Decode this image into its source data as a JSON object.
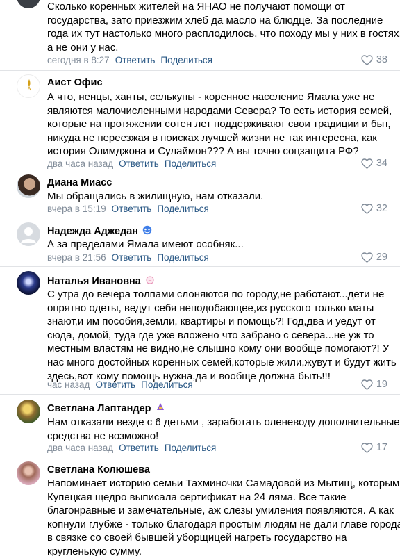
{
  "actions": {
    "reply": "Ответить",
    "share": "Поделиться"
  },
  "comments": [
    {
      "name": "",
      "lines": [
        "Сколько коренных жителей на ЯНАО не получают помощи от",
        "государства, зато приезжим хлеб да масло на блюдце. За последние",
        "года их тут настолько много расплодилось, что походу мы у них в гостях,",
        "а не они у нас."
      ],
      "time": "сегодня в 8:27",
      "likes": "38"
    },
    {
      "name": "Аист Офис",
      "avatar_logo": "АИСТ-АСТ",
      "lines": [
        "А что, ненцы, ханты, селькупы - коренное население Ямала уже не",
        "являются малочисленными народами Севера? То есть история семей,",
        "которые на протяжении сотен лет поддерживают свои традиции и быт,",
        "никуда не переезжая в поисках лучшей жизни не так интересна, как",
        "история Олимджона и Сулаймон??? А вы точно соцзащита РФ?"
      ],
      "time": "два часа назад",
      "likes": "34"
    },
    {
      "name": "Диана Миасс",
      "lines": [
        "Мы обращались в жилищную, нам отказали."
      ],
      "time": "вчера в 15:19",
      "likes": "32"
    },
    {
      "name": "Надежда Аджедан",
      "lines": [
        "А за пределами Ямала имеют особняк..."
      ],
      "time": "вчера в 21:56",
      "likes": "29"
    },
    {
      "name": "Наталья Ивановна",
      "lines": [
        "С утра до вечера толпами слоняются по городу,не работают...дети не",
        "опрятно одеты, ведут себя неподобающее,из русского только маты",
        "знают,и им пособия,земли, квартиры и помощь?! Год,два и уедут от",
        "сюда, домой, туда где уже вложено что забрано с севера...не уж то",
        "местным властям не видно,не слышно кому они вообще помогают?! У",
        "нас много достойных коренных семей,которые жили,жувут и будут жить",
        "здесь,вот кому помощь нужна,да и вообще должна быть!!!"
      ],
      "time": "час назад",
      "likes": "19"
    },
    {
      "name": "Светлана Лаптандер",
      "lines": [
        "Нам отказали везде с 6 детьми , заработать оленеводу дополнительные",
        "средства не возможно!"
      ],
      "time": "два часа назад",
      "likes": "17"
    },
    {
      "name": "Светлана Колюшева",
      "lines": [
        "Напоминает историю семьи Тахминочки Самадовой из Мытищ, которым",
        "Купецкая щедро выписала сертификат на 24 ляма. Все такие",
        "благонравные и замечательные, аж слезы умиления появляются. А как",
        "копнули глубже - только благодаря простым людям не дали главе города",
        "в связке со своей бывшей уборщицей нагреть государство на",
        "кругленькую сумму."
      ]
    }
  ]
}
